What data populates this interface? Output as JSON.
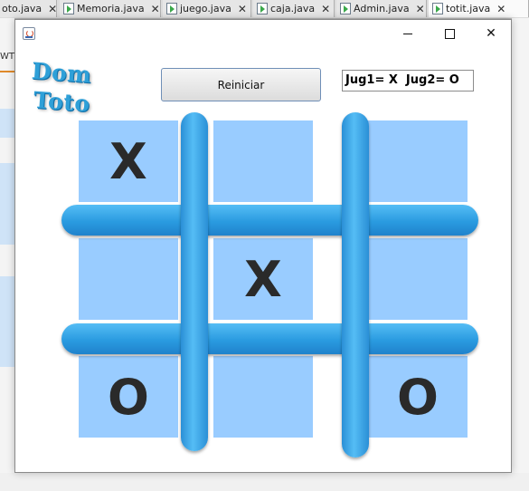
{
  "ide": {
    "tabs": [
      {
        "label": "oto.java",
        "active": false
      },
      {
        "label": "Memoria.java",
        "active": false
      },
      {
        "label": "juego.java",
        "active": false
      },
      {
        "label": "caja.java",
        "active": false
      },
      {
        "label": "Admin.java",
        "active": false
      },
      {
        "label": "totit.java",
        "active": true
      }
    ],
    "side_text": "WT"
  },
  "window": {
    "minimize_icon": "minimize-icon",
    "maximize_icon": "maximize-icon",
    "close_label": "✕"
  },
  "app": {
    "logo_line1": "Dom",
    "logo_line2": "Toto",
    "reset_label": "Reiniciar",
    "score": "Jug1= X  Jug2= O"
  },
  "board": {
    "cells": [
      "X",
      "",
      "",
      "",
      "X",
      "",
      "O",
      "",
      "O"
    ],
    "cell_color": "#99ccff",
    "grid_color": "#2a9be0"
  }
}
